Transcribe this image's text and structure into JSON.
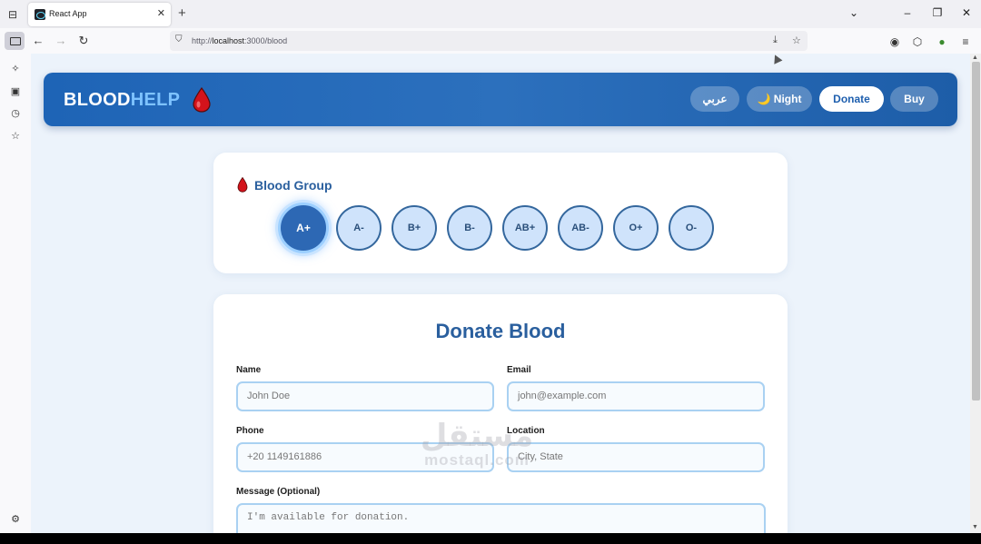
{
  "browser": {
    "tab_title": "React App",
    "url_prefix": "http://",
    "url_host": "localhost",
    "url_path": ":3000/blood",
    "tab_close": "✕",
    "new_tab": "+",
    "chevron": "⌄"
  },
  "window_controls": {
    "minimize": "–",
    "maximize": "❐",
    "close": "✕"
  },
  "app": {
    "logo_part1": "BLOOD",
    "logo_part2": "HELP",
    "header_buttons": {
      "language": "عربي",
      "night": "🌙 Night",
      "donate": "Donate",
      "buy": "Buy"
    }
  },
  "blood_group": {
    "title": "Blood Group",
    "groups": [
      "A+",
      "A-",
      "B+",
      "B-",
      "AB+",
      "AB-",
      "O+",
      "O-"
    ],
    "selected": "A+"
  },
  "form": {
    "title": "Donate Blood",
    "name_label": "Name",
    "name_placeholder": "John Doe",
    "email_label": "Email",
    "email_placeholder": "john@example.com",
    "phone_label": "Phone",
    "phone_value": "+20 1149161886",
    "location_label": "Location",
    "location_placeholder": "City, State",
    "message_label": "Message (Optional)",
    "message_placeholder": "I'm available for donation."
  },
  "watermark": {
    "arabic": "مستقل",
    "latin": "mostaql.com"
  },
  "colors": {
    "primary": "#2d68b4",
    "accent": "#7ec3ff",
    "drop_red": "#d3131b",
    "page_bg": "#ecf3fb"
  }
}
